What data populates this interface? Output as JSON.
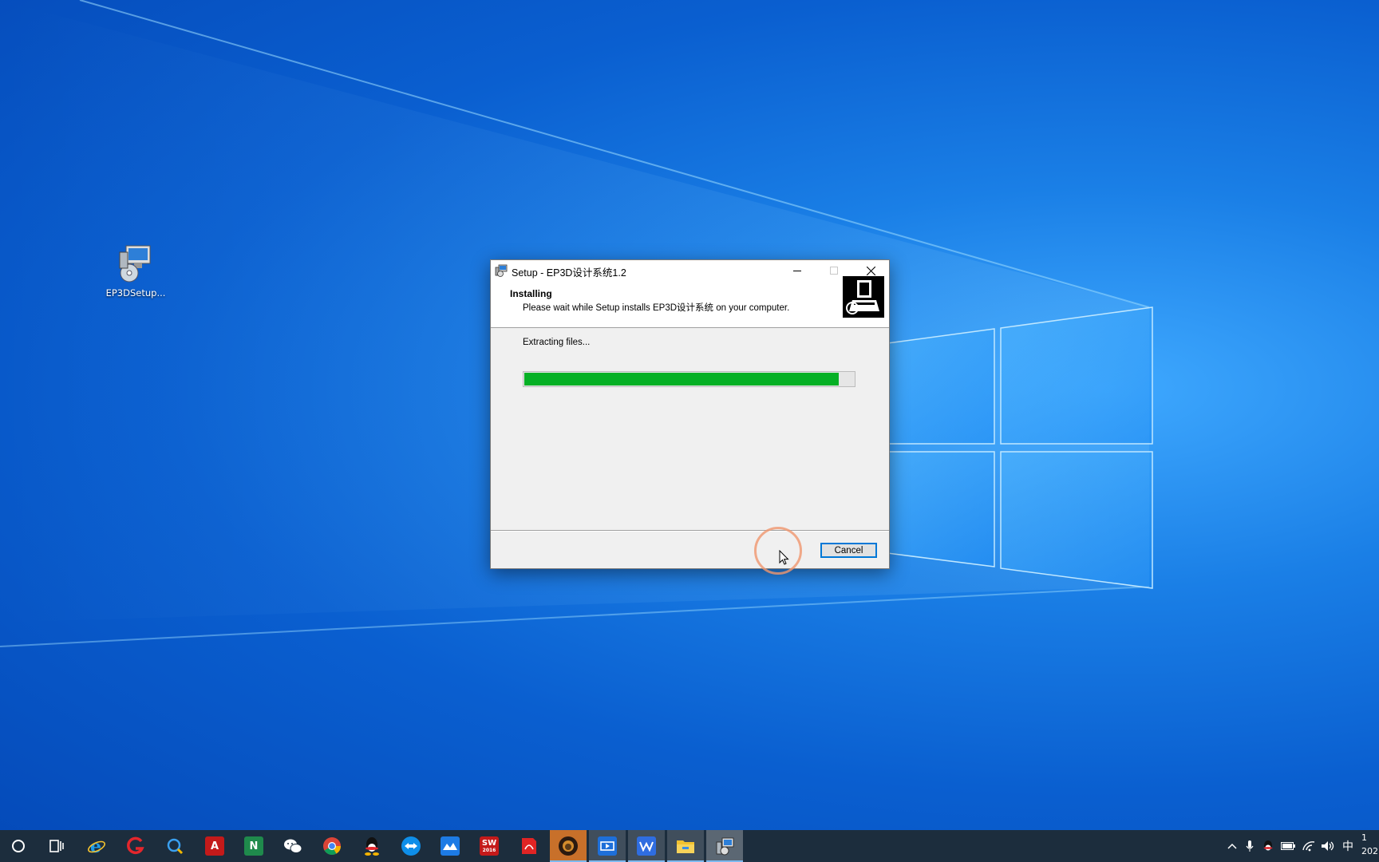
{
  "desktop": {
    "icons": [
      {
        "label": "EP3DSetup...",
        "icon": "installer-icon"
      }
    ]
  },
  "dialog": {
    "title": "Setup - EP3D设计系统1.2",
    "header_title": "Installing",
    "header_subtitle": "Please wait while Setup installs EP3D设计系统 on your computer.",
    "status_text": "Extracting files...",
    "progress": 0.953,
    "progress_color": "#06b025",
    "cancel_label": "Cancel",
    "accent_color": "#0078d7"
  },
  "taskbar": {
    "pinned": [
      "cortana-search-icon",
      "task-view-icon",
      "internet-explorer-icon",
      "app-red-g-icon",
      "app-search-q-icon",
      "autocad-icon",
      "app-n-icon",
      "wechat-icon",
      "chrome-icon",
      "qq-icon",
      "teamviewer-icon",
      "app-blue-cloud-icon",
      "solidworks-2016-icon",
      "app-red-pdf-icon",
      "app-lion-icon",
      "video-conference-icon",
      "wps-writer-icon",
      "file-explorer-icon",
      "setup-installer-icon"
    ],
    "solidworks_label": "SW",
    "solidworks_year": "2016",
    "autocad_letter": "A",
    "app_n_letter": "N",
    "ime_label": "中",
    "clock_time": "1",
    "clock_date": "202"
  }
}
